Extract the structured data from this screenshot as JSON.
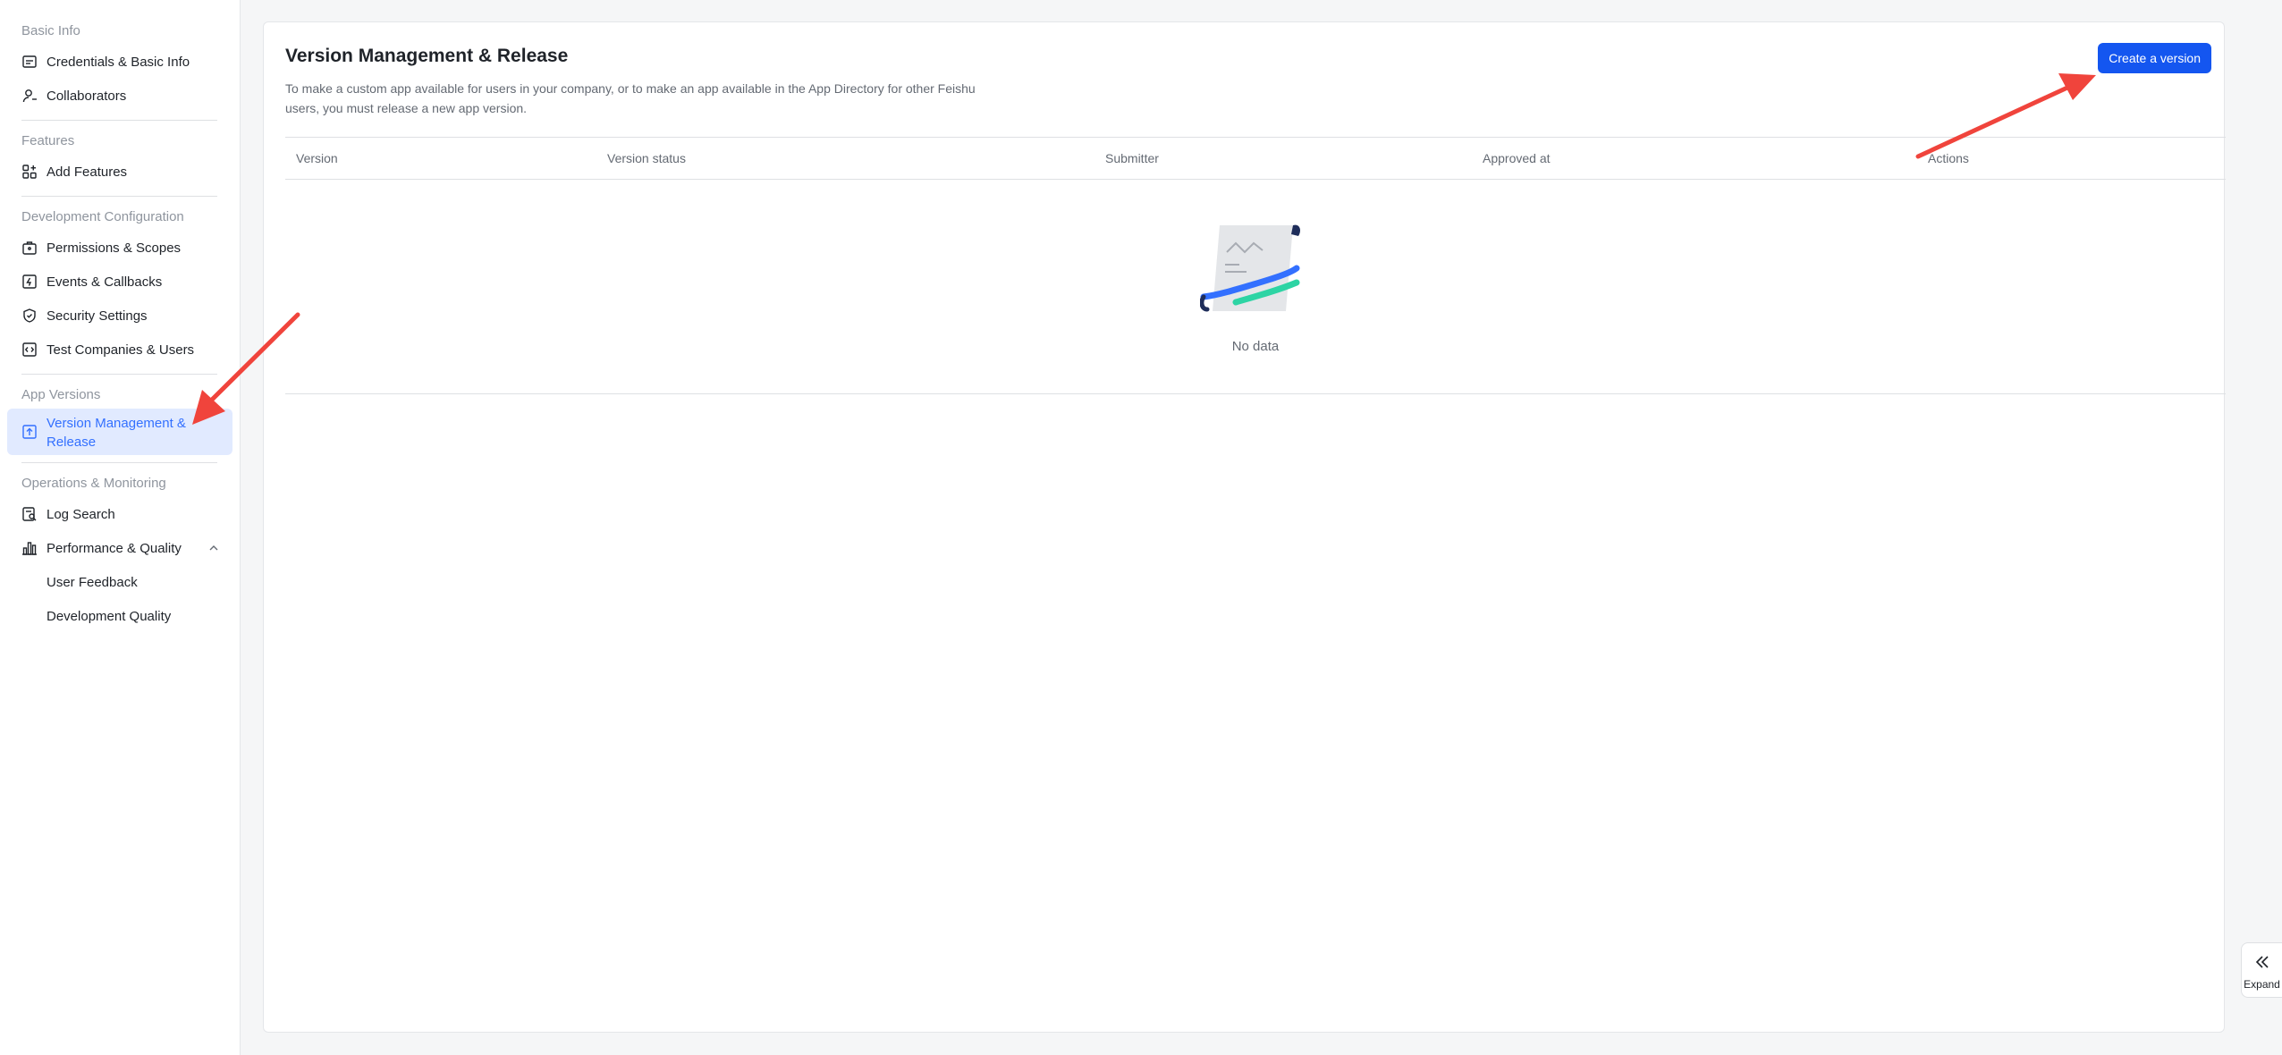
{
  "sidebar": {
    "groups": [
      {
        "title": "Basic Info",
        "items": [
          "Credentials & Basic Info",
          "Collaborators"
        ]
      },
      {
        "title": "Features",
        "items": [
          "Add Features"
        ]
      },
      {
        "title": "Development Configuration",
        "items": [
          "Permissions & Scopes",
          "Events & Callbacks",
          "Security Settings",
          "Test Companies & Users"
        ]
      },
      {
        "title": "App Versions",
        "items": [
          "Version Management & Release"
        ]
      },
      {
        "title": "Operations & Monitoring",
        "items": [
          "Log Search",
          "Performance & Quality",
          "User Feedback",
          "Development Quality"
        ]
      }
    ]
  },
  "main": {
    "title": "Version Management & Release",
    "description": "To make a custom app available for users in your company, or to make an app available in the App Directory for other Feishu users, you must release a new app version.",
    "create_button": "Create a version",
    "table": {
      "columns": [
        "Version",
        "Version status",
        "Submitter",
        "Approved at",
        "Actions"
      ],
      "empty_text": "No data"
    }
  },
  "expand": {
    "label": "Expand"
  },
  "colors": {
    "primary": "#1456f0",
    "active_bg": "#e1eaff",
    "active_text": "#3370ff",
    "annotation": "#f0443c"
  }
}
